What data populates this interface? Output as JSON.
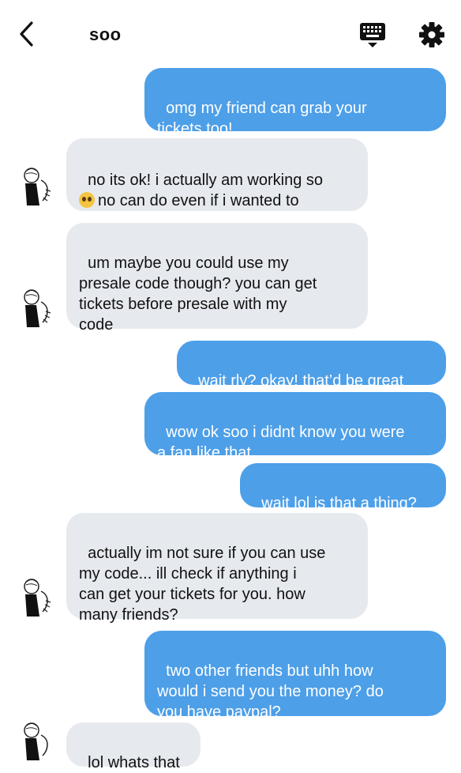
{
  "header": {
    "title": "soo",
    "back_icon": "chevron-left-icon",
    "keyboard_icon": "keyboard-hide-icon",
    "settings_icon": "gear-icon"
  },
  "colors": {
    "outgoing_bubble": "#4d9fe8",
    "incoming_bubble": "#e6e9ee"
  },
  "messages": [
    {
      "dir": "out",
      "text": "omg my friend can grab your\ntickets too!"
    },
    {
      "dir": "in",
      "text": "no its ok! i actually am working so",
      "text2": "no can do even if i wanted to",
      "emoji": "pleading-face-emoji"
    },
    {
      "dir": "in",
      "text": "um maybe you could use my\npresale code though? you can get\ntickets before presale with my\ncode"
    },
    {
      "dir": "out",
      "text": "wait rly? okay! that’d be great"
    },
    {
      "dir": "out",
      "text": "wow ok soo i didnt know you were\na fan like that"
    },
    {
      "dir": "out",
      "text": "wait lol is that a thing?"
    },
    {
      "dir": "in",
      "text": "actually im not sure if you can use\nmy code... ill check if anything i\ncan get your tickets for you. how\nmany friends?"
    },
    {
      "dir": "out",
      "text": "two other friends but uhh how\nwould i send you the money? do\nyou have paypal?"
    },
    {
      "dir": "in",
      "text": "lol whats that"
    }
  ]
}
